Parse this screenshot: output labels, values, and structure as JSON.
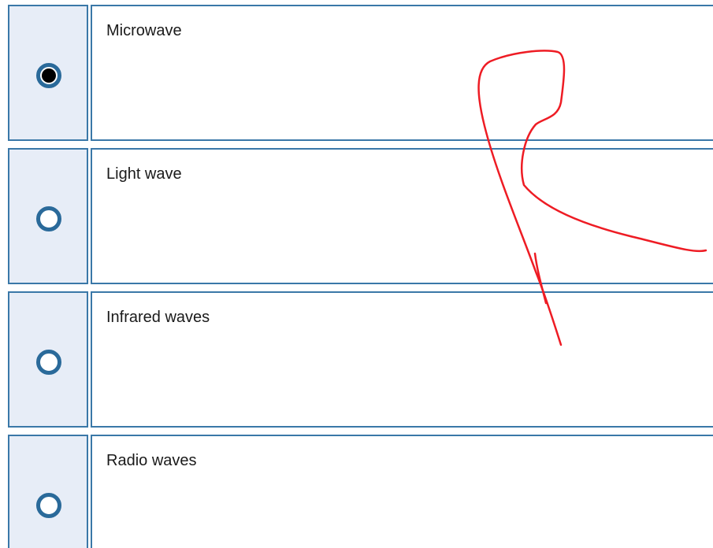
{
  "colors": {
    "border": "#3a78a8",
    "selector_bg": "#e7edf7",
    "radio_ring": "#2a6a9a",
    "annotation": "#ee1c24"
  },
  "question": {
    "options": [
      {
        "label": "Microwave",
        "selected": true
      },
      {
        "label": "Light wave",
        "selected": false
      },
      {
        "label": "Infrared waves",
        "selected": false
      },
      {
        "label": "Radio waves",
        "selected": false
      }
    ]
  },
  "annotation": {
    "type": "freehand-pen-stroke"
  }
}
